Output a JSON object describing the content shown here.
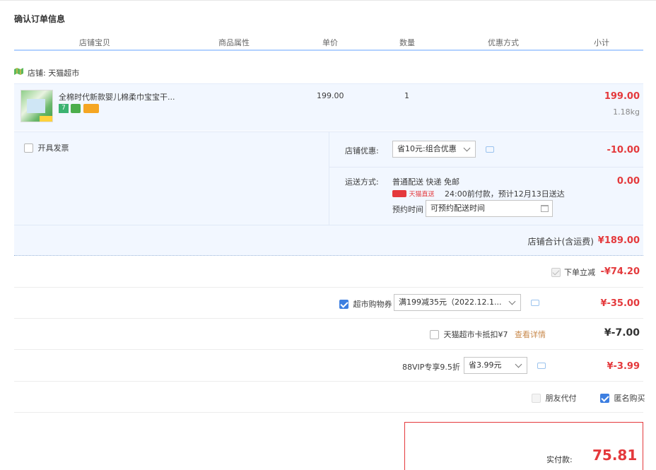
{
  "page_title": "确认订单信息",
  "columns": [
    "店铺宝贝",
    "商品属性",
    "单价",
    "数量",
    "优惠方式",
    "小计"
  ],
  "shop": {
    "label": "店铺: 天猫超市"
  },
  "item": {
    "title": "全棉时代新款婴儿棉柔巾宝宝干...",
    "price": "199.00",
    "quantity": "1",
    "subtotal": "199.00",
    "weight": "1.18kg"
  },
  "invoice": {
    "label": "开具发票"
  },
  "store_discount": {
    "label": "店铺优惠:",
    "selected": "省10元:组合优惠",
    "amount": "-10.00"
  },
  "shipping": {
    "label": "运送方式:",
    "method": "普通配送 快递 免邮",
    "badge": "天猫直送",
    "eta": "24:00前付款，预计12月13日送达",
    "schedule_label": "预约时间",
    "schedule_placeholder": "可预约配送时间",
    "amount": "0.00"
  },
  "store_total": {
    "label": "店铺合计(含运费)",
    "amount": "¥189.00"
  },
  "instant_discount": {
    "label": "下单立减",
    "amount": "-¥74.20"
  },
  "coupon": {
    "label": "超市购物券",
    "selected": "满199减35元（2022.12.1...",
    "amount": "¥-35.00"
  },
  "tmall_card": {
    "label": "天猫超市卡抵扣¥7",
    "link": "查看详情",
    "amount": "¥-7.00"
  },
  "vip": {
    "label": "88VIP专享9.5折",
    "selected": "省3.99元",
    "amount": "¥-3.99"
  },
  "pay_options": {
    "friend": "朋友代付",
    "anonymous": "匿名购买"
  },
  "summary": {
    "pay_label": "实付款:",
    "pay_amount": "75.81"
  },
  "colors": {
    "accent_red": "#e4393c",
    "header_blue": "#b2d1ff",
    "row_blue": "#f2f7ff"
  },
  "icons": [
    "shop-icon",
    "chevron-down-icon",
    "message-icon",
    "calendar-icon"
  ]
}
